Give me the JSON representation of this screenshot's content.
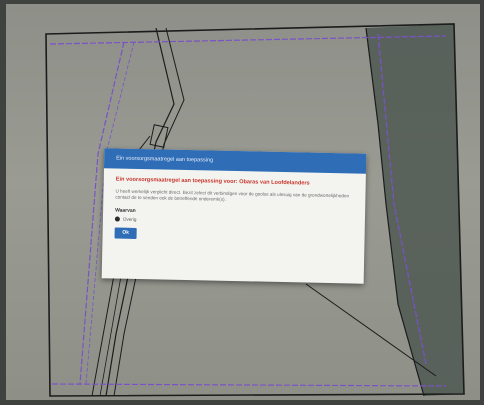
{
  "dialog": {
    "title": "Ein voorsorgsmaatregel aan toepassing",
    "heading": "Ein voorsorgsmaatregel aan toepassing voor: Obaras van Loofdelanders",
    "message": "U heeft werkelijk verplicht direct. Bezit zelect dit verbindigen voor de goolse als ulesuig van de grondwortelijkheden contact de te senden ook de betreffende onderemk(s).",
    "section_label": "Waarvan",
    "option_label": "Overig",
    "ok_label": "Ok"
  },
  "colors": {
    "header": "#2f6db7",
    "heading_red": "#c8352c",
    "parcel_line": "#1c1c1c",
    "boundary_purple": "#7a52c8"
  }
}
